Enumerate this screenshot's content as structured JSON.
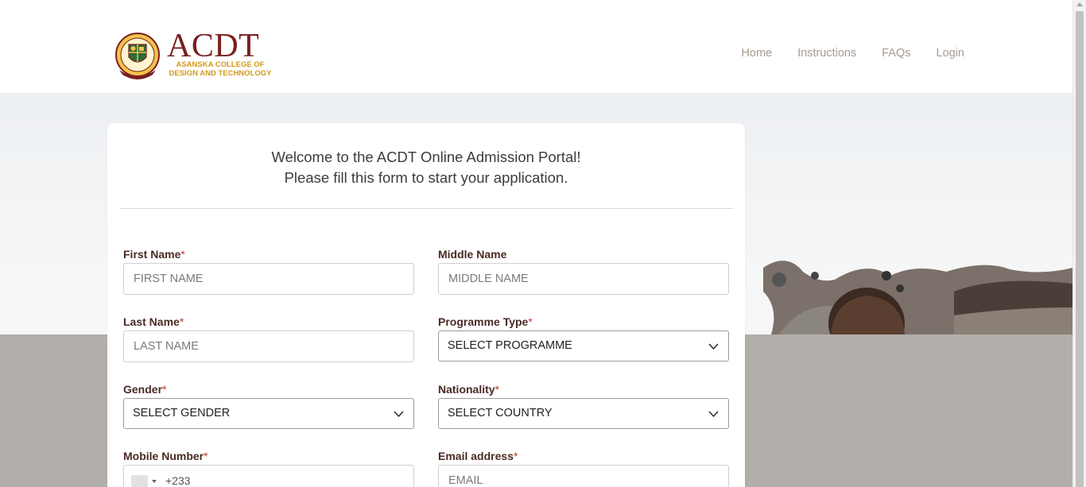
{
  "brand": {
    "name": "ACDT",
    "tagline_line1": "ASANSKA COLLEGE OF",
    "tagline_line2": "DESIGN AND TECHNOLOGY",
    "primary_color": "#7a1f1f",
    "accent_color": "#d39a16"
  },
  "nav": {
    "items": [
      {
        "label": "Home"
      },
      {
        "label": "Instructions"
      },
      {
        "label": "FAQs"
      },
      {
        "label": "Login"
      }
    ]
  },
  "card": {
    "welcome_line1": "Welcome to the ACDT Online Admission Portal!",
    "welcome_line2": "Please fill this form to start your application."
  },
  "form": {
    "required_mark": "*",
    "first_name": {
      "label": "First Name",
      "placeholder": "FIRST NAME"
    },
    "middle_name": {
      "label": "Middle Name",
      "placeholder": "MIDDLE NAME"
    },
    "last_name": {
      "label": "Last Name",
      "placeholder": "LAST NAME"
    },
    "programme_type": {
      "label": "Programme Type",
      "value": "SELECT PROGRAMME"
    },
    "gender": {
      "label": "Gender",
      "value": "SELECT GENDER"
    },
    "nationality": {
      "label": "Nationality",
      "value": "SELECT COUNTRY"
    },
    "mobile_number": {
      "label": "Mobile Number",
      "code": "+233"
    },
    "email": {
      "label": "Email address",
      "placeholder": "EMAIL"
    }
  },
  "icons": {
    "logo": "college-crest-icon",
    "select": "chevron-down-icon",
    "phone": "country-flag-icon"
  }
}
